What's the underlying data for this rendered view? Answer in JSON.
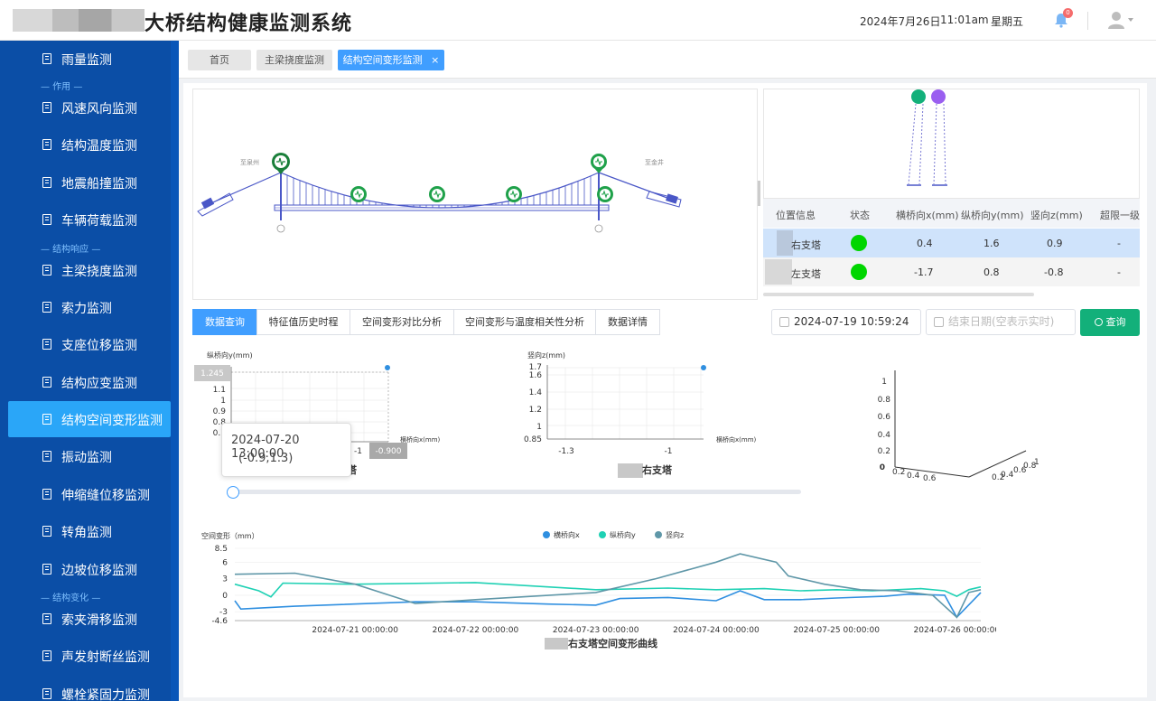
{
  "header": {
    "title": "大桥结构健康监测系统",
    "date": "2024年7月26日",
    "time": "11:01am",
    "weekday": "星期五",
    "notification_count": "0"
  },
  "sidebar": {
    "items": [
      {
        "label": "雨量监测"
      },
      {
        "label": "风速风向监测"
      },
      {
        "label": "结构温度监测"
      },
      {
        "label": "地震船撞监测"
      },
      {
        "label": "车辆荷载监测"
      },
      {
        "label": "主梁挠度监测"
      },
      {
        "label": "索力监测"
      },
      {
        "label": "支座位移监测"
      },
      {
        "label": "结构应变监测"
      },
      {
        "label": "结构空间变形监测"
      },
      {
        "label": "振动监测"
      },
      {
        "label": "伸缩缝位移监测"
      },
      {
        "label": "转角监测"
      },
      {
        "label": "边坡位移监测"
      },
      {
        "label": "索夹滑移监测"
      },
      {
        "label": "声发射断丝监测"
      },
      {
        "label": "螺栓紧固力监测"
      }
    ],
    "groups": [
      "— 作用 —",
      "— 结构响应 —",
      "— 结构变化 —"
    ],
    "active": "结构空间变形监测"
  },
  "tabs": [
    {
      "label": "首页"
    },
    {
      "label": "主梁挠度监测"
    },
    {
      "label": "结构空间变形监测",
      "close": "×"
    }
  ],
  "bridge": {
    "left_label": "至泉州",
    "right_label": "至金井"
  },
  "table": {
    "headers": [
      "位置信息",
      "状态",
      "横桥向x(mm)",
      "纵桥向y(mm)",
      "竖向z(mm)",
      "超限一级"
    ],
    "rows": [
      {
        "location": "右支塔",
        "x": "0.4",
        "y": "1.6",
        "z": "0.9",
        "limit": "-"
      },
      {
        "location": "左支塔",
        "x": "-1.7",
        "y": "0.8",
        "z": "-0.8",
        "limit": "-"
      }
    ]
  },
  "analysis_tabs": [
    "数据查询",
    "特征值历史时程",
    "空间变形对比分析",
    "空间变形与温度相关性分析",
    "数据详情"
  ],
  "query": {
    "start_date": "2024-07-19 10:59:24",
    "end_placeholder": "结束日期(空表示实时)",
    "button": "查询"
  },
  "chart1": {
    "ylabel": "纵桥向y(mm)",
    "xlabel": "横桥向x(mm)",
    "yticks": [
      "1.1",
      "1",
      "0.9",
      "0.8",
      "0.7"
    ],
    "xtick": "-1",
    "ypointer": "1.245",
    "xpointer": "-0.900",
    "caption": "右支塔"
  },
  "chart2": {
    "ylabel": "竖向z(mm)",
    "xlabel": "横桥向x(mm)",
    "yticks": [
      "1.7",
      "1.6",
      "1.4",
      "1.2",
      "1",
      "0.85"
    ],
    "xticks": [
      "-1.3",
      "-1"
    ],
    "caption": "右支塔"
  },
  "chart3d": {
    "zticks": [
      "1",
      "0.8",
      "0.6",
      "0.4",
      "0.2",
      "0"
    ],
    "xticks": [
      "0.2",
      "0.4",
      "0.6"
    ],
    "yticks": [
      "0.2",
      "0.4",
      "0.6",
      "0.8",
      "1"
    ]
  },
  "tooltip": {
    "time": "2024-07-20 13:00:00",
    "value": "(-0.9,1.3)"
  },
  "chart_data": {
    "type": "line",
    "title": "右支塔空间变形曲线",
    "ylabel": "空间变形（mm）",
    "ylim": [
      -4.6,
      8.5
    ],
    "yticks": [
      "8.5",
      "6",
      "3",
      "0",
      "-3",
      "-4.6"
    ],
    "x_ticks": [
      "2024-07-21 00:00:00",
      "2024-07-22 00:00:00",
      "2024-07-23 00:00:00",
      "2024-07-24 00:00:00",
      "2024-07-25 00:00:00",
      "2024-07-26 00:00:00"
    ],
    "xlim": [
      -1.0,
      5.2
    ],
    "series": [
      {
        "name": "横桥向x",
        "color": "#2f8fe0",
        "points": [
          [
            -1.0,
            -1.0
          ],
          [
            -0.95,
            -2.5
          ],
          [
            -0.5,
            -2.0
          ],
          [
            0.5,
            -1.2
          ],
          [
            1.0,
            -1.2
          ],
          [
            1.6,
            -1.6
          ],
          [
            2.0,
            -1.8
          ],
          [
            2.2,
            -0.6
          ],
          [
            2.6,
            -0.4
          ],
          [
            3.0,
            -1.0
          ],
          [
            3.2,
            0.8
          ],
          [
            3.4,
            -0.8
          ],
          [
            3.7,
            -0.8
          ],
          [
            4.0,
            -0.5
          ],
          [
            4.4,
            -0.2
          ],
          [
            4.6,
            0.2
          ],
          [
            4.9,
            0.0
          ],
          [
            5.0,
            -4.0
          ],
          [
            5.2,
            0.5
          ]
        ]
      },
      {
        "name": "纵桥向y",
        "color": "#1fd1b4",
        "points": [
          [
            -1.0,
            2.0
          ],
          [
            -0.8,
            0.8
          ],
          [
            -0.7,
            -0.3
          ],
          [
            -0.6,
            2.2
          ],
          [
            0.0,
            2.0
          ],
          [
            1.0,
            2.3
          ],
          [
            2.0,
            1.0
          ],
          [
            2.6,
            1.3
          ],
          [
            3.0,
            1.0
          ],
          [
            3.4,
            1.2
          ],
          [
            3.7,
            0.8
          ],
          [
            4.0,
            1.0
          ],
          [
            4.3,
            0.8
          ],
          [
            4.7,
            1.2
          ],
          [
            4.9,
            0.8
          ],
          [
            5.0,
            -0.2
          ],
          [
            5.1,
            1.0
          ],
          [
            5.2,
            1.5
          ]
        ]
      },
      {
        "name": "竖向z",
        "color": "#5f97a8",
        "points": [
          [
            -1.0,
            3.8
          ],
          [
            -0.5,
            4.0
          ],
          [
            0.0,
            2.0
          ],
          [
            0.5,
            -1.5
          ],
          [
            1.0,
            -0.8
          ],
          [
            2.0,
            0.5
          ],
          [
            2.5,
            3.0
          ],
          [
            3.0,
            6.0
          ],
          [
            3.2,
            7.5
          ],
          [
            3.5,
            6.0
          ],
          [
            3.6,
            3.5
          ],
          [
            3.9,
            2.0
          ],
          [
            4.2,
            1.0
          ],
          [
            4.5,
            0.8
          ],
          [
            4.8,
            0.0
          ],
          [
            5.0,
            -4.0
          ],
          [
            5.1,
            0.5
          ],
          [
            5.2,
            1.0
          ]
        ]
      }
    ]
  }
}
